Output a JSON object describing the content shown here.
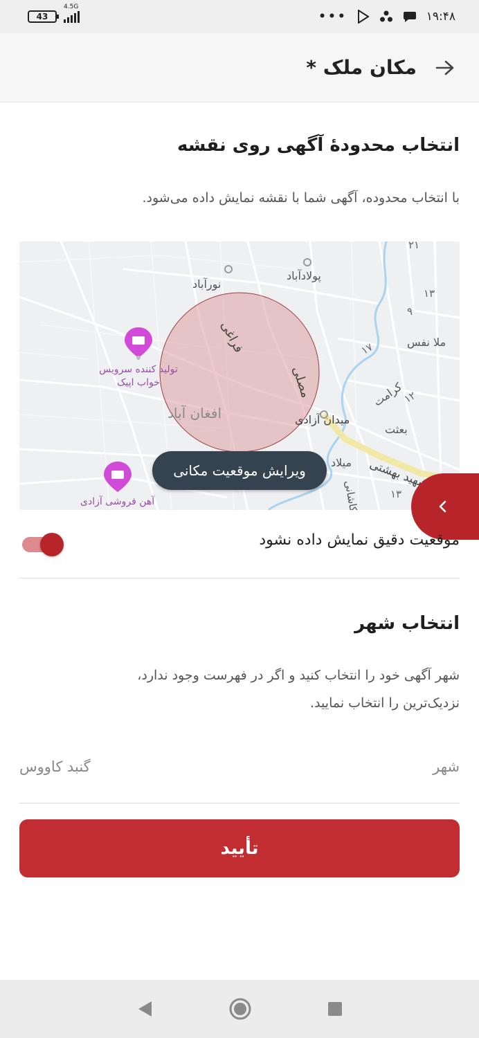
{
  "status_bar": {
    "battery": "43",
    "network": "4.5G",
    "dots": "•••",
    "time": "۱۹:۴۸"
  },
  "header": {
    "title": "مکان ملک *",
    "back_icon": "arrow-right-icon"
  },
  "map_section": {
    "title": "انتخاب محدودهٔ آگهی روی نقشه",
    "description": "با انتخاب محدوده، آگهی شما با نقشه نمایش داده می‌شود.",
    "map_labels": {
      "nourabad": "نورآباد",
      "pouladabad": "پولادآباد",
      "faraghi": "فراغی",
      "mosalla": "مصلی",
      "afghanabad": "افغان آباد",
      "meydan_azadi": "میدان آزادی",
      "karamat": "کرامت",
      "beasat": "بعثت",
      "molla_nafas": "ملا نفس",
      "shahid_beheshti": "شهید بهشتی",
      "milad": "میلاد",
      "kashani": "کاشانی",
      "poi_1_line1": "تولید کننده سرویس",
      "poi_1_line2": "خواب اپیک",
      "poi_2": "آهن فروشی آزادی",
      "num_21": "۲۱",
      "num_13": "۱۳",
      "num_9": "۹",
      "num_17": "۱۷",
      "num_12": "۱۲",
      "num_13b": "۱۳"
    },
    "edit_button": "ویرایش موقعیت مکانی",
    "toggle_label": "موقعیت دقیق نمایش داده نشود",
    "toggle_on": true
  },
  "city_section": {
    "title": "انتخاب شهر",
    "description_line1": "شهر آگهی خود را انتخاب کنید و اگر در فهرست وجود ندارد،",
    "description_line2": "نزدیک‌ترین را انتخاب نمایید.",
    "field_label": "شهر",
    "field_value": "گنبد کاووس"
  },
  "confirm_button": "تأیید",
  "colors": {
    "primary": "#c22d32",
    "tooltip_bg": "#34434f",
    "map_bg": "#eef0f2",
    "area_circle": "#e8b9bb",
    "poi": "#d24bd8"
  }
}
